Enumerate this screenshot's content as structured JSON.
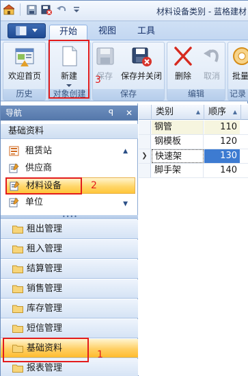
{
  "window": {
    "title": "材料设备类别 - 蓝格建材"
  },
  "tabs": [
    {
      "label": "开始",
      "active": true
    },
    {
      "label": "视图",
      "active": false
    },
    {
      "label": "工具",
      "active": false
    }
  ],
  "ribbon": {
    "groups": [
      {
        "label": "历史",
        "buttons": [
          {
            "label": "欢迎首页",
            "icon": "home-icon",
            "enabled": true
          }
        ]
      },
      {
        "label": "对象创建",
        "buttons": [
          {
            "label": "新建",
            "icon": "new-document-icon",
            "enabled": true
          }
        ]
      },
      {
        "label": "保存",
        "buttons": [
          {
            "label": "保存",
            "icon": "save-icon",
            "enabled": false
          },
          {
            "label": "保存并关闭",
            "icon": "save-close-icon",
            "enabled": true
          }
        ]
      },
      {
        "label": "编辑",
        "buttons": [
          {
            "label": "删除",
            "icon": "delete-icon",
            "enabled": true
          },
          {
            "label": "取消",
            "icon": "undo-icon",
            "enabled": false
          }
        ]
      },
      {
        "label": "记录",
        "buttons": [
          {
            "label": "批量",
            "icon": "batch-icon",
            "enabled": true
          }
        ]
      }
    ]
  },
  "nav": {
    "header": "导航",
    "pin": "ꟼ",
    "close": "✕",
    "section_title": "基础资料",
    "items": [
      {
        "label": "租赁站",
        "selected": false
      },
      {
        "label": "供应商",
        "selected": false
      },
      {
        "label": "材料设备",
        "selected": true
      },
      {
        "label": "单位",
        "selected": false
      }
    ],
    "modules": [
      {
        "label": "租出管理",
        "selected": false
      },
      {
        "label": "租入管理",
        "selected": false
      },
      {
        "label": "结算管理",
        "selected": false
      },
      {
        "label": "销售管理",
        "selected": false
      },
      {
        "label": "库存管理",
        "selected": false
      },
      {
        "label": "短信管理",
        "selected": false
      },
      {
        "label": "基础资料",
        "selected": true
      },
      {
        "label": "报表管理",
        "selected": false
      }
    ]
  },
  "grid": {
    "columns": [
      "类别",
      "顺序"
    ],
    "rows": [
      {
        "name": "钢管",
        "order": "110",
        "selected": false
      },
      {
        "name": "钢模板",
        "order": "120",
        "selected": false
      },
      {
        "name": "快速架",
        "order": "130",
        "selected": true
      },
      {
        "name": "脚手架",
        "order": "140",
        "selected": false
      }
    ],
    "current_row_marker": "❯"
  },
  "annotations": {
    "one": "1",
    "two": "2",
    "three": "3"
  },
  "colors": {
    "accent": "#1f4b93",
    "selection": "#ffc53a",
    "annotation": "#e21b1b"
  }
}
